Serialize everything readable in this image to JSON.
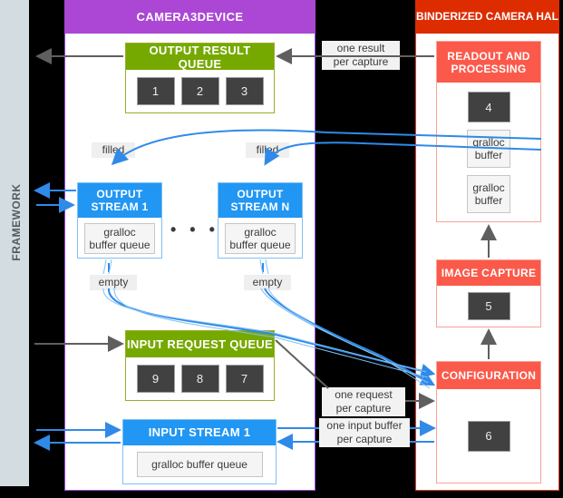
{
  "diagram": {
    "title": "Camera3Device / Binderized Camera HAL data flow",
    "colors": {
      "framework_bg": "#d3dce0",
      "camera3device_header": "#ab47d4",
      "hal_header": "#dd2c00",
      "queue_green": "#76a900",
      "stream_blue": "#2196f3",
      "hal_block_red": "#fb5a4b",
      "chip_gray": "#414141",
      "gap_black": "#000000",
      "arrow_blue": "#2f8ae8",
      "arrow_gray": "#5f5f5f"
    }
  },
  "framework": {
    "label": "FRAMEWORK"
  },
  "camera3device": {
    "title": "CAMERA3DEVICE",
    "output_result_queue": {
      "title": "OUTPUT RESULT QUEUE",
      "items": [
        "1",
        "2",
        "3"
      ]
    },
    "output_streams": [
      {
        "title": "OUTPUT\nSTREAM 1",
        "buffer_label": "gralloc\nbuffer queue",
        "in_label": "filled",
        "out_label": "empty"
      },
      {
        "title": "OUTPUT\nSTREAM N",
        "buffer_label": "gralloc\nbuffer queue",
        "in_label": "filled",
        "out_label": "empty"
      }
    ],
    "ellipsis": "• • •",
    "input_request_queue": {
      "title": "INPUT REQUEST QUEUE",
      "items": [
        "9",
        "8",
        "7"
      ]
    },
    "input_stream": {
      "title": "INPUT STREAM 1",
      "buffer_label": "gralloc buffer queue"
    }
  },
  "hal": {
    "title": "BINDERIZED CAMERA HAL",
    "blocks": [
      {
        "title": "READOUT AND PROCESSING",
        "chip": "4",
        "buffers": [
          "gralloc\nbuffer",
          "gralloc\nbuffer"
        ]
      },
      {
        "title": "IMAGE CAPTURE",
        "chip": "5",
        "buffers": []
      },
      {
        "title": "CONFIGURATION",
        "chip": "6",
        "buffers": []
      }
    ]
  },
  "edge_labels": {
    "one_result_per_capture": "one result\nper capture",
    "one_request_per_capture": "one request\nper capture",
    "one_input_buffer_per_capture": "one input buffer\nper capture"
  }
}
